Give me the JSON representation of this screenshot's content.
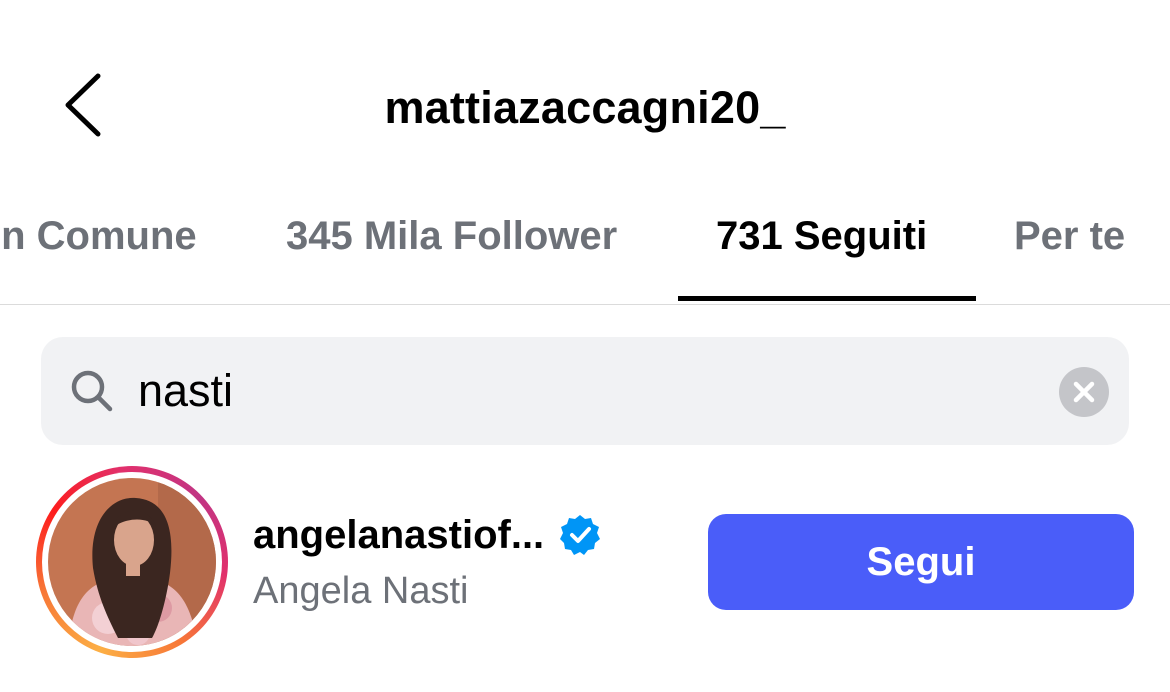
{
  "header": {
    "title": "mattiazaccagni20_",
    "back_icon": "chevron-left-icon"
  },
  "tabs": [
    {
      "label": "In Comune",
      "active": false
    },
    {
      "label": "345 Mila Follower",
      "active": false
    },
    {
      "label": "731 Seguiti",
      "active": true
    },
    {
      "label": "Per te",
      "active": false
    }
  ],
  "search": {
    "value": "nasti",
    "search_icon": "search-icon",
    "clear_icon": "clear-icon"
  },
  "results": [
    {
      "username": "angelanastiof...",
      "verified": true,
      "full_name": "Angela Nasti",
      "button_label": "Segui"
    }
  ],
  "colors": {
    "accent": "#4a5df9",
    "verified": "#0095f6",
    "secondary_text": "#6d7178",
    "search_bg": "#f1f2f4"
  }
}
